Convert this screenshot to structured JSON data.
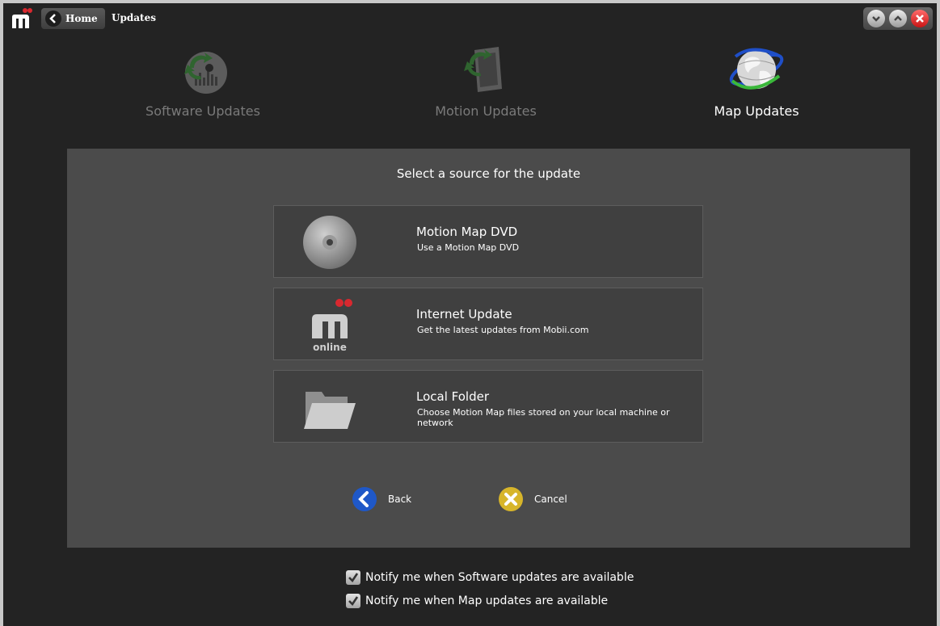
{
  "titlebar": {
    "home_label": "Home",
    "breadcrumb": "Updates",
    "icons": [
      "app-logo",
      "back-chevron-icon",
      "minimize-icon",
      "maximize-icon",
      "close-icon"
    ]
  },
  "tabs": [
    {
      "label": "Software Updates",
      "icon": "software-updates-icon",
      "active": false
    },
    {
      "label": "Motion Updates",
      "icon": "motion-updates-icon",
      "active": false
    },
    {
      "label": "Map Updates",
      "icon": "globe-icon",
      "active": true
    }
  ],
  "panel": {
    "title": "Select a source for the update",
    "options": [
      {
        "title": "Motion Map DVD",
        "description": "Use a Motion Map DVD",
        "icon": "dvd-icon"
      },
      {
        "title": "Internet Update",
        "description": "Get the latest updates from Mobii.com",
        "icon": "mobii-online-icon",
        "icon_text": "online"
      },
      {
        "title": "Local Folder",
        "description": "Choose Motion Map files stored on your local machine or network",
        "icon": "folder-icon"
      }
    ],
    "back_label": "Back",
    "cancel_label": "Cancel"
  },
  "notifications": [
    {
      "label": "Notify me when Software updates are available",
      "checked": true
    },
    {
      "label": "Notify me when Map updates are available",
      "checked": true
    }
  ],
  "colors": {
    "window_bg": "#232323",
    "panel_bg": "#4b4b4b",
    "option_bg": "#404040",
    "brand_red": "#d9282f",
    "back_blue": "#1f58c8",
    "cancel_gold": "#d7b52a"
  }
}
